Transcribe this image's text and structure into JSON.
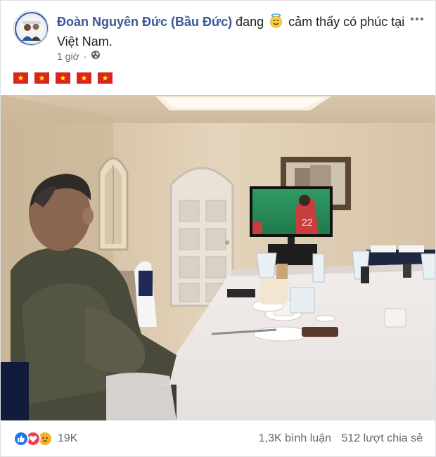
{
  "post": {
    "author": "Đoàn Nguyên Đức (Bầu Đức)",
    "status_prefix": " đang ",
    "status_feeling": " cảm thấy có phúc tại Việt Nam.",
    "time": "1 giờ",
    "time_separator": "·",
    "privacy_icon": "globe-icon",
    "flag_count": 5,
    "flag_icon": "vietnam-flag-icon"
  },
  "stats": {
    "reactions_count": "19K",
    "reaction_icons": [
      "like-icon",
      "love-icon",
      "sad-icon"
    ],
    "comments": "1,3K bình luận",
    "shares": "512 lượt chia sẻ"
  },
  "colors": {
    "author": "#385898",
    "meta": "#606770",
    "like": "#1877f2",
    "love": "#f33e58",
    "sad": "#f7b125",
    "flag_red": "#da251d",
    "flag_star": "#ffff00"
  }
}
